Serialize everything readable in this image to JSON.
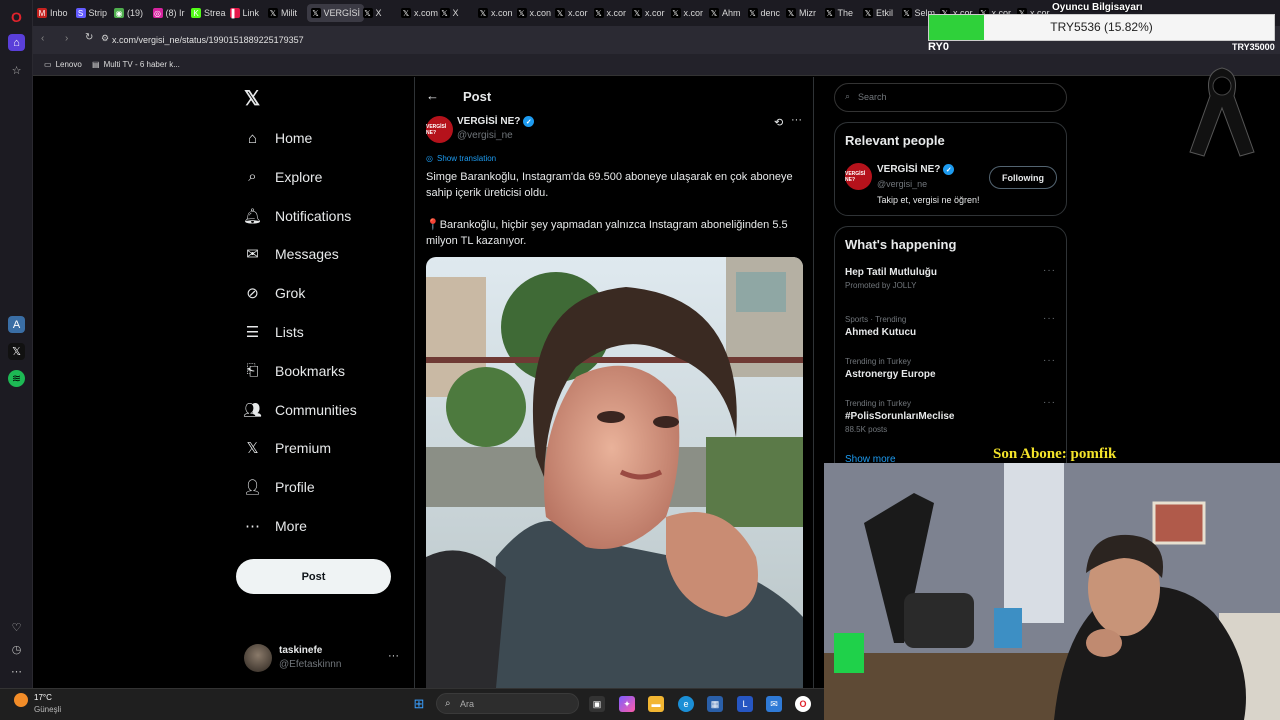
{
  "browser": {
    "tabs": [
      {
        "label": "Inbo",
        "icon": "gmail-icon"
      },
      {
        "label": "Strip",
        "icon": "stripe-icon"
      },
      {
        "label": "(19)",
        "icon": "chat-icon"
      },
      {
        "label": "(8) Ir",
        "icon": "instagram-icon"
      },
      {
        "label": "Strea",
        "icon": "kick-icon"
      },
      {
        "label": "Link",
        "icon": "link-icon"
      },
      {
        "label": "Milit",
        "icon": "x-icon"
      },
      {
        "label": "VERGİSİ",
        "icon": "x-icon"
      },
      {
        "label": "X",
        "icon": "x-icon"
      },
      {
        "label": "x.com",
        "icon": "x-icon"
      },
      {
        "label": "X",
        "icon": "x-icon"
      },
      {
        "label": "x.con",
        "icon": "x-icon"
      },
      {
        "label": "x.con",
        "icon": "x-icon"
      },
      {
        "label": "x.cor",
        "icon": "x-icon"
      },
      {
        "label": "x.cor",
        "icon": "x-icon"
      },
      {
        "label": "x.cor",
        "icon": "x-icon"
      },
      {
        "label": "x.cor",
        "icon": "x-icon"
      },
      {
        "label": "Ahm",
        "icon": "x-icon"
      },
      {
        "label": "denc",
        "icon": "x-icon"
      },
      {
        "label": "Mizr",
        "icon": "x-icon"
      },
      {
        "label": "The",
        "icon": "x-icon"
      },
      {
        "label": "Etkil",
        "icon": "x-icon"
      },
      {
        "label": "Selm",
        "icon": "x-icon"
      },
      {
        "label": "x.cor",
        "icon": "x-icon"
      },
      {
        "label": "x.cor",
        "icon": "x-icon"
      },
      {
        "label": "x.cor",
        "icon": "x-icon"
      }
    ],
    "url": "x.com/vergisi_ne/status/1990151889225179357",
    "bookmarks": [
      "Lenovo",
      "Multi TV - 6 haber k..."
    ]
  },
  "x": {
    "nav": [
      {
        "label": "Home",
        "icon": "home-icon"
      },
      {
        "label": "Explore",
        "icon": "search-icon"
      },
      {
        "label": "Notifications",
        "icon": "bell-icon"
      },
      {
        "label": "Messages",
        "icon": "mail-icon"
      },
      {
        "label": "Grok",
        "icon": "grok-icon"
      },
      {
        "label": "Lists",
        "icon": "list-icon"
      },
      {
        "label": "Bookmarks",
        "icon": "bookmark-icon"
      },
      {
        "label": "Communities",
        "icon": "people-icon"
      },
      {
        "label": "Premium",
        "icon": "x-icon"
      },
      {
        "label": "Profile",
        "icon": "user-icon"
      },
      {
        "label": "More",
        "icon": "more-circle-icon"
      }
    ],
    "post_button": "Post",
    "account": {
      "name": "taskinefe",
      "handle": "@Efetaskinnn"
    },
    "header_title": "Post",
    "tweet": {
      "author_name": "VERGİSİ NE?",
      "author_handle": "@vergisi_ne",
      "avatar_text": "VERGİSİ NE?",
      "show_translation": "Show translation",
      "paragraph1": "Simge Barankoğlu, Instagram'da 69.500 aboneye ulaşarak en çok aboneye sahip içerik üreticisi oldu.",
      "paragraph2": "Barankoğlu, hiçbir şey yapmadan yalnızca Instagram aboneliğinden 5.5 milyon TL kazanıyor."
    },
    "search_placeholder": "Search",
    "relevant": {
      "title": "Relevant people",
      "name": "VERGİSİ NE?",
      "handle": "@vergisi_ne",
      "bio": "Takip et, vergisi ne öğren!",
      "follow_label": "Following"
    },
    "happening": {
      "title": "What's happening",
      "trends": [
        {
          "category": "Promoted by JOLLY",
          "name": "Hep Tatil Mutluluğu",
          "promoted": true
        },
        {
          "category": "Sports · Trending",
          "name": "Ahmed Kutucu"
        },
        {
          "category": "Trending in Turkey",
          "name": "Astronergy Europe"
        },
        {
          "category": "Trending in Turkey",
          "name": "#PolisSorunlarıMeclise",
          "posts": "88.5K posts"
        }
      ],
      "show_more": "Show more"
    }
  },
  "overlay": {
    "goal_label": "Oyuncu Bilgisayarı",
    "goal_progress": "TRY5536 (15.82%)",
    "goal_fraction": 0.1582,
    "goal_start": "RY0",
    "goal_end": "TRY35000",
    "last_sub": "Son Abone: pomfik"
  },
  "taskbar": {
    "weather_temp": "17°C",
    "weather_desc": "Güneşli",
    "search_placeholder": "Ara"
  },
  "colors": {
    "accent": "#1d9bf0",
    "goal_fill": "#2fd13a",
    "sub_text": "#f3e32a",
    "brand_red": "#b5121b"
  }
}
